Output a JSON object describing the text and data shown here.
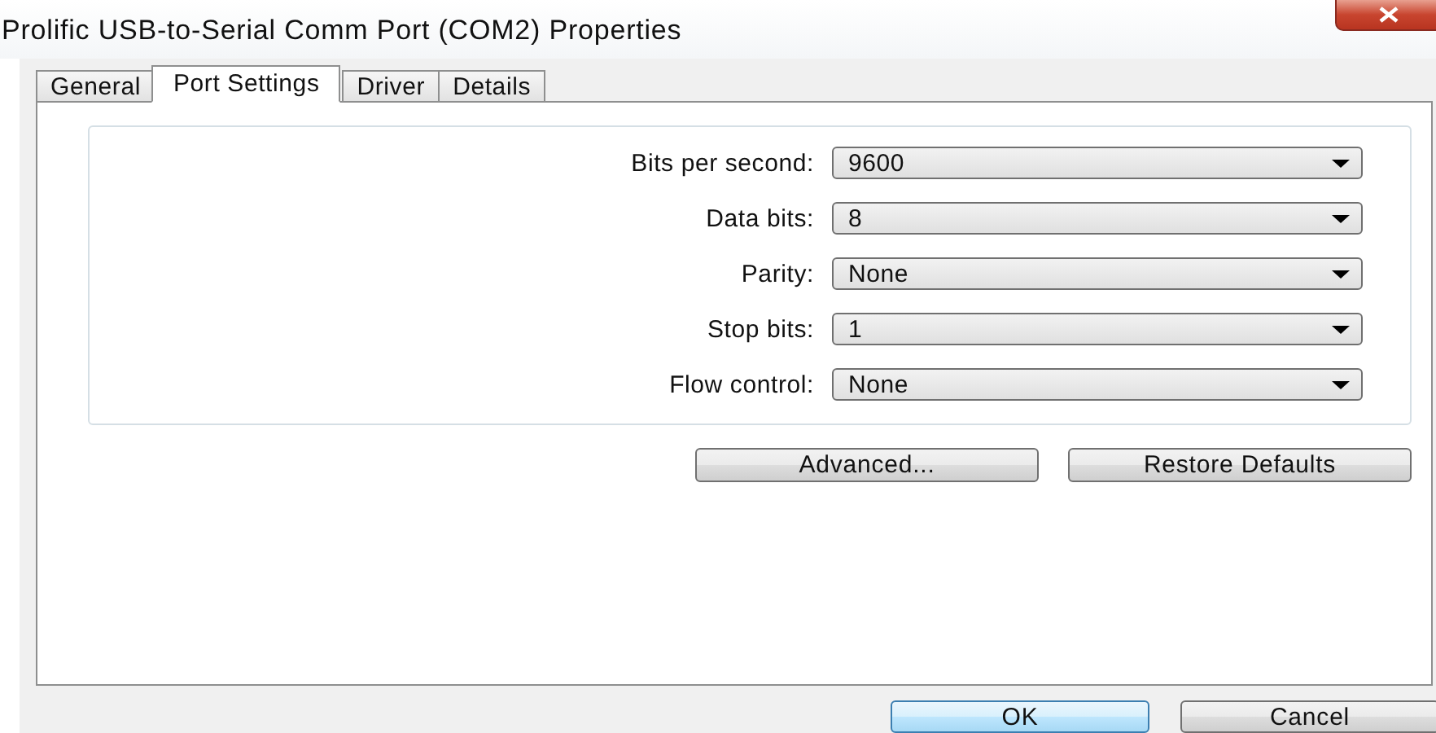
{
  "window": {
    "title": "Prolific USB-to-Serial Comm Port (COM2) Properties"
  },
  "tabs": [
    {
      "label": "General",
      "selected": false
    },
    {
      "label": "Port Settings",
      "selected": true
    },
    {
      "label": "Driver",
      "selected": false
    },
    {
      "label": "Details",
      "selected": false
    }
  ],
  "settings": [
    {
      "label": "Bits per second:",
      "value": "9600"
    },
    {
      "label": "Data bits:",
      "value": "8"
    },
    {
      "label": "Parity:",
      "value": "None"
    },
    {
      "label": "Stop bits:",
      "value": "1"
    },
    {
      "label": "Flow control:",
      "value": "None"
    }
  ],
  "panel_buttons": [
    "Advanced...",
    "Restore Defaults"
  ],
  "dialog_buttons": [
    {
      "label": "OK",
      "default": true
    },
    {
      "label": "Cancel",
      "default": false
    }
  ]
}
